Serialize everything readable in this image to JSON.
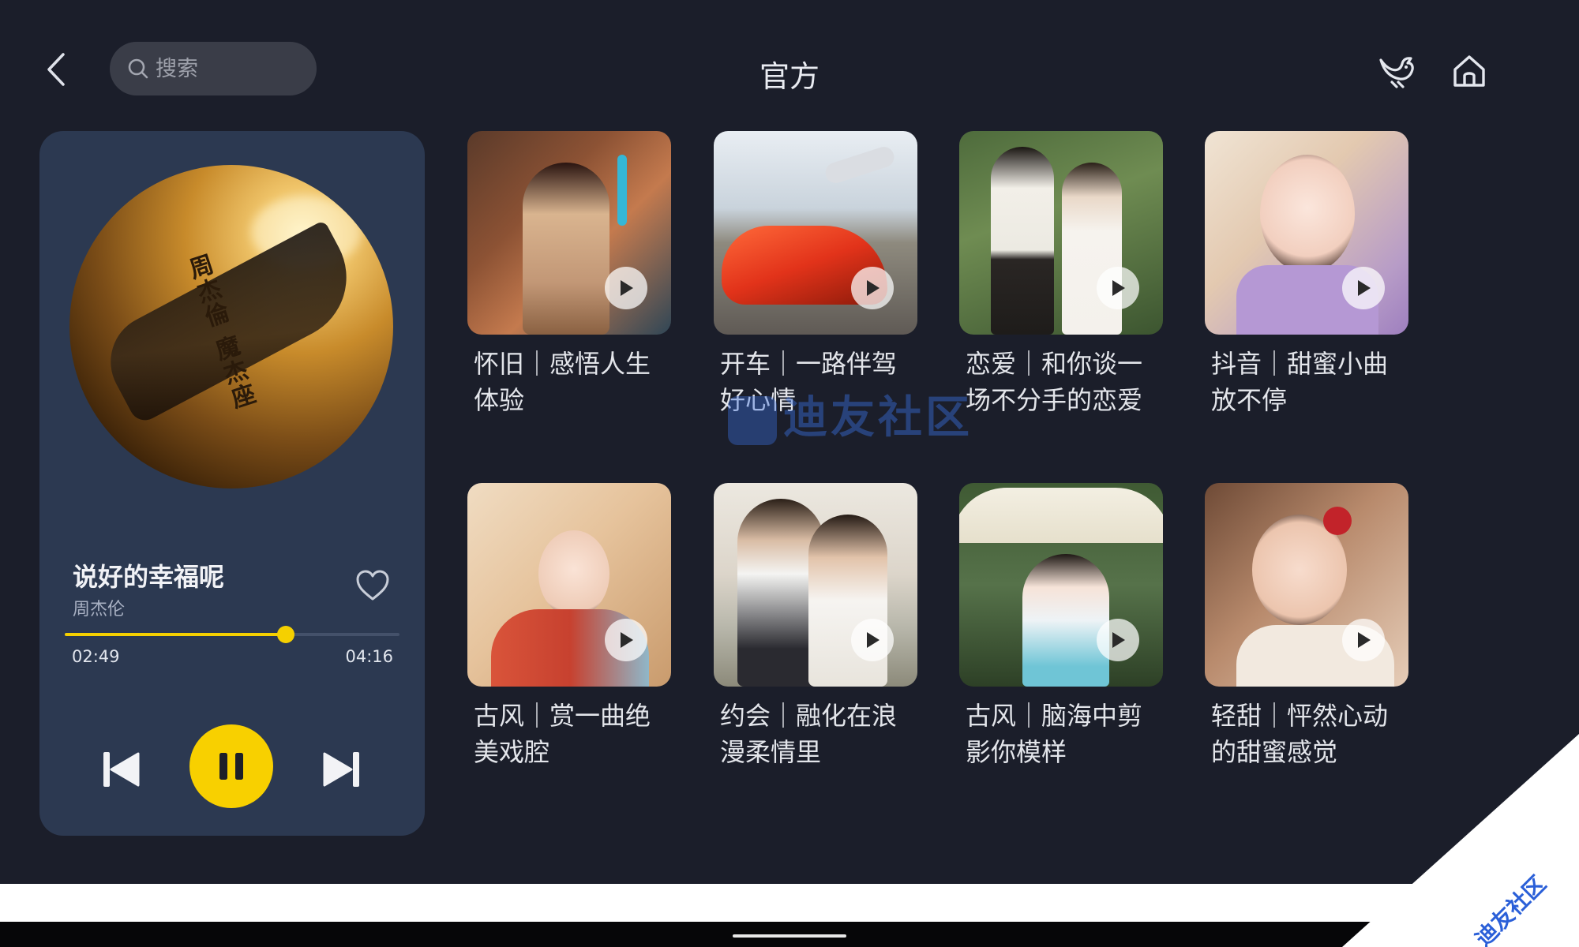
{
  "header": {
    "title": "官方",
    "search_placeholder": "搜索",
    "icons": [
      "back-icon",
      "search-icon",
      "bird-icon",
      "home-icon"
    ]
  },
  "player": {
    "song_title": "说好的幸福呢",
    "artist": "周杰伦",
    "album_text": "周杰倫 魔杰座",
    "current_time": "02:49",
    "total_time": "04:16",
    "progress": 0.66,
    "is_playing": true,
    "accent_color": "#f8d000"
  },
  "playlists": [
    {
      "title": "怀旧｜感悟人生体验"
    },
    {
      "title": "开车｜一路伴驾好心情"
    },
    {
      "title": "恋爱｜和你谈一场不分手的恋爱"
    },
    {
      "title": "抖音｜甜蜜小曲放不停"
    },
    {
      "title": "古风｜赏一曲绝美戏腔"
    },
    {
      "title": "约会｜融化在浪漫柔情里"
    },
    {
      "title": "古风｜脑海中剪影你模样"
    },
    {
      "title": "轻甜｜怦然心动的甜蜜感觉"
    }
  ],
  "watermark": {
    "center_text": "迪友社区",
    "corner_text": "迪友社区"
  },
  "colors": {
    "background": "#1b1e2a",
    "panel": "#2c3951",
    "accent": "#f8d000"
  }
}
